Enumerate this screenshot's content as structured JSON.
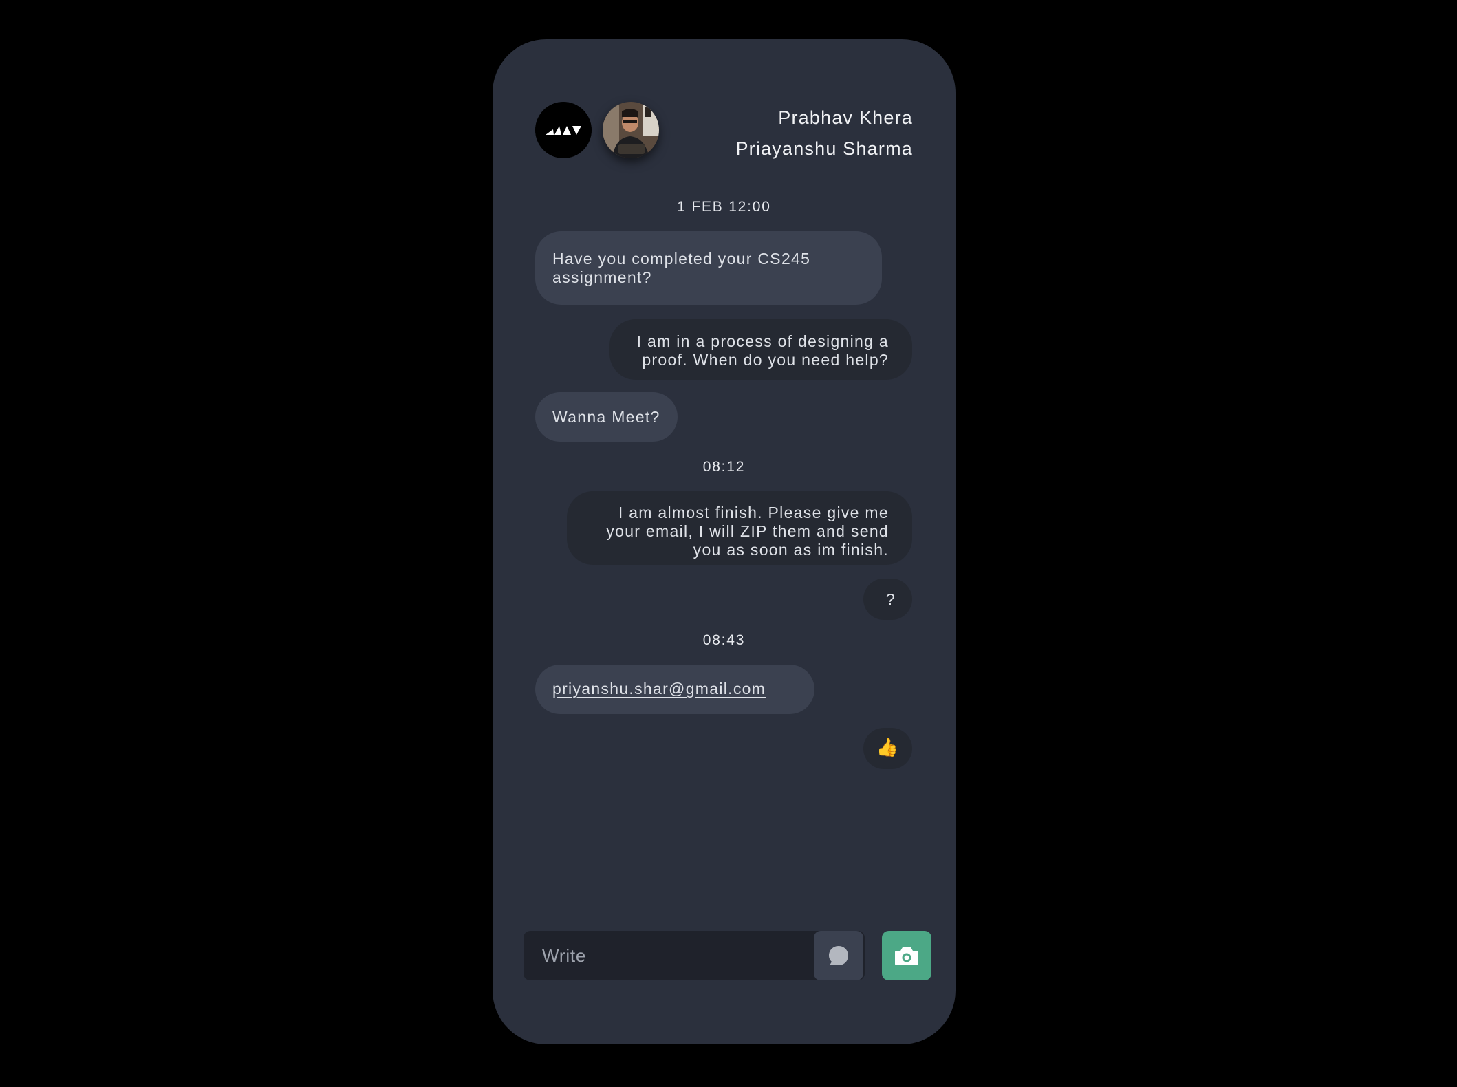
{
  "header": {
    "name_primary": "Prabhav Khera",
    "name_secondary": "Priayanshu Sharma",
    "logo_icon": "brand-logo-icon",
    "photo_icon": "user-photo"
  },
  "timestamps": [
    "1 FEB 12:00",
    "08:12",
    "08:43"
  ],
  "messages": [
    {
      "direction": "in",
      "text": "Have you completed your CS245 assignment?"
    },
    {
      "direction": "out",
      "text": "I am in a process of designing a proof. When do you need help?"
    },
    {
      "direction": "in",
      "text": "Wanna Meet?"
    },
    {
      "direction": "out",
      "text": "I am almost finish. Please give me your email, I will ZIP them and send you as soon as im finish."
    },
    {
      "direction": "out",
      "text": "?"
    },
    {
      "direction": "in",
      "text": "priyanshu.shar@gmail.com"
    },
    {
      "direction": "out",
      "text": "👍"
    }
  ],
  "composer": {
    "placeholder": "Write",
    "chat_icon": "speech-bubble-icon",
    "camera_icon": "camera-icon"
  },
  "colors": {
    "background": "#000000",
    "panel": "#2b303d",
    "incoming_bubble": "#3b4150",
    "outgoing_bubble": "#252932",
    "accent": "#4ca886"
  }
}
